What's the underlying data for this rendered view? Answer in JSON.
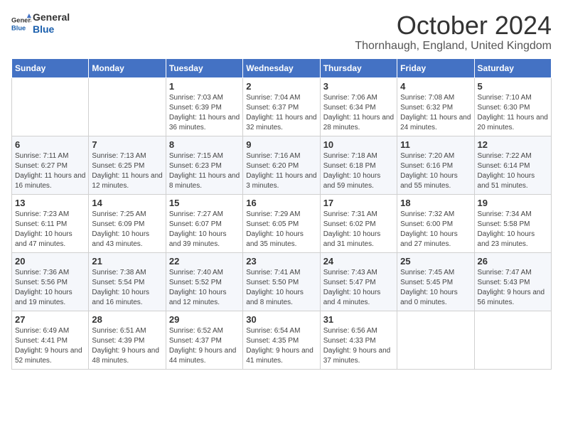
{
  "header": {
    "logo_general": "General",
    "logo_blue": "Blue",
    "month_title": "October 2024",
    "subtitle": "Thornhaugh, England, United Kingdom"
  },
  "days_of_week": [
    "Sunday",
    "Monday",
    "Tuesday",
    "Wednesday",
    "Thursday",
    "Friday",
    "Saturday"
  ],
  "weeks": [
    [
      {
        "day": "",
        "info": ""
      },
      {
        "day": "",
        "info": ""
      },
      {
        "day": "1",
        "info": "Sunrise: 7:03 AM\nSunset: 6:39 PM\nDaylight: 11 hours and 36 minutes."
      },
      {
        "day": "2",
        "info": "Sunrise: 7:04 AM\nSunset: 6:37 PM\nDaylight: 11 hours and 32 minutes."
      },
      {
        "day": "3",
        "info": "Sunrise: 7:06 AM\nSunset: 6:34 PM\nDaylight: 11 hours and 28 minutes."
      },
      {
        "day": "4",
        "info": "Sunrise: 7:08 AM\nSunset: 6:32 PM\nDaylight: 11 hours and 24 minutes."
      },
      {
        "day": "5",
        "info": "Sunrise: 7:10 AM\nSunset: 6:30 PM\nDaylight: 11 hours and 20 minutes."
      }
    ],
    [
      {
        "day": "6",
        "info": "Sunrise: 7:11 AM\nSunset: 6:27 PM\nDaylight: 11 hours and 16 minutes."
      },
      {
        "day": "7",
        "info": "Sunrise: 7:13 AM\nSunset: 6:25 PM\nDaylight: 11 hours and 12 minutes."
      },
      {
        "day": "8",
        "info": "Sunrise: 7:15 AM\nSunset: 6:23 PM\nDaylight: 11 hours and 8 minutes."
      },
      {
        "day": "9",
        "info": "Sunrise: 7:16 AM\nSunset: 6:20 PM\nDaylight: 11 hours and 3 minutes."
      },
      {
        "day": "10",
        "info": "Sunrise: 7:18 AM\nSunset: 6:18 PM\nDaylight: 10 hours and 59 minutes."
      },
      {
        "day": "11",
        "info": "Sunrise: 7:20 AM\nSunset: 6:16 PM\nDaylight: 10 hours and 55 minutes."
      },
      {
        "day": "12",
        "info": "Sunrise: 7:22 AM\nSunset: 6:14 PM\nDaylight: 10 hours and 51 minutes."
      }
    ],
    [
      {
        "day": "13",
        "info": "Sunrise: 7:23 AM\nSunset: 6:11 PM\nDaylight: 10 hours and 47 minutes."
      },
      {
        "day": "14",
        "info": "Sunrise: 7:25 AM\nSunset: 6:09 PM\nDaylight: 10 hours and 43 minutes."
      },
      {
        "day": "15",
        "info": "Sunrise: 7:27 AM\nSunset: 6:07 PM\nDaylight: 10 hours and 39 minutes."
      },
      {
        "day": "16",
        "info": "Sunrise: 7:29 AM\nSunset: 6:05 PM\nDaylight: 10 hours and 35 minutes."
      },
      {
        "day": "17",
        "info": "Sunrise: 7:31 AM\nSunset: 6:02 PM\nDaylight: 10 hours and 31 minutes."
      },
      {
        "day": "18",
        "info": "Sunrise: 7:32 AM\nSunset: 6:00 PM\nDaylight: 10 hours and 27 minutes."
      },
      {
        "day": "19",
        "info": "Sunrise: 7:34 AM\nSunset: 5:58 PM\nDaylight: 10 hours and 23 minutes."
      }
    ],
    [
      {
        "day": "20",
        "info": "Sunrise: 7:36 AM\nSunset: 5:56 PM\nDaylight: 10 hours and 19 minutes."
      },
      {
        "day": "21",
        "info": "Sunrise: 7:38 AM\nSunset: 5:54 PM\nDaylight: 10 hours and 16 minutes."
      },
      {
        "day": "22",
        "info": "Sunrise: 7:40 AM\nSunset: 5:52 PM\nDaylight: 10 hours and 12 minutes."
      },
      {
        "day": "23",
        "info": "Sunrise: 7:41 AM\nSunset: 5:50 PM\nDaylight: 10 hours and 8 minutes."
      },
      {
        "day": "24",
        "info": "Sunrise: 7:43 AM\nSunset: 5:47 PM\nDaylight: 10 hours and 4 minutes."
      },
      {
        "day": "25",
        "info": "Sunrise: 7:45 AM\nSunset: 5:45 PM\nDaylight: 10 hours and 0 minutes."
      },
      {
        "day": "26",
        "info": "Sunrise: 7:47 AM\nSunset: 5:43 PM\nDaylight: 9 hours and 56 minutes."
      }
    ],
    [
      {
        "day": "27",
        "info": "Sunrise: 6:49 AM\nSunset: 4:41 PM\nDaylight: 9 hours and 52 minutes."
      },
      {
        "day": "28",
        "info": "Sunrise: 6:51 AM\nSunset: 4:39 PM\nDaylight: 9 hours and 48 minutes."
      },
      {
        "day": "29",
        "info": "Sunrise: 6:52 AM\nSunset: 4:37 PM\nDaylight: 9 hours and 44 minutes."
      },
      {
        "day": "30",
        "info": "Sunrise: 6:54 AM\nSunset: 4:35 PM\nDaylight: 9 hours and 41 minutes."
      },
      {
        "day": "31",
        "info": "Sunrise: 6:56 AM\nSunset: 4:33 PM\nDaylight: 9 hours and 37 minutes."
      },
      {
        "day": "",
        "info": ""
      },
      {
        "day": "",
        "info": ""
      }
    ]
  ]
}
